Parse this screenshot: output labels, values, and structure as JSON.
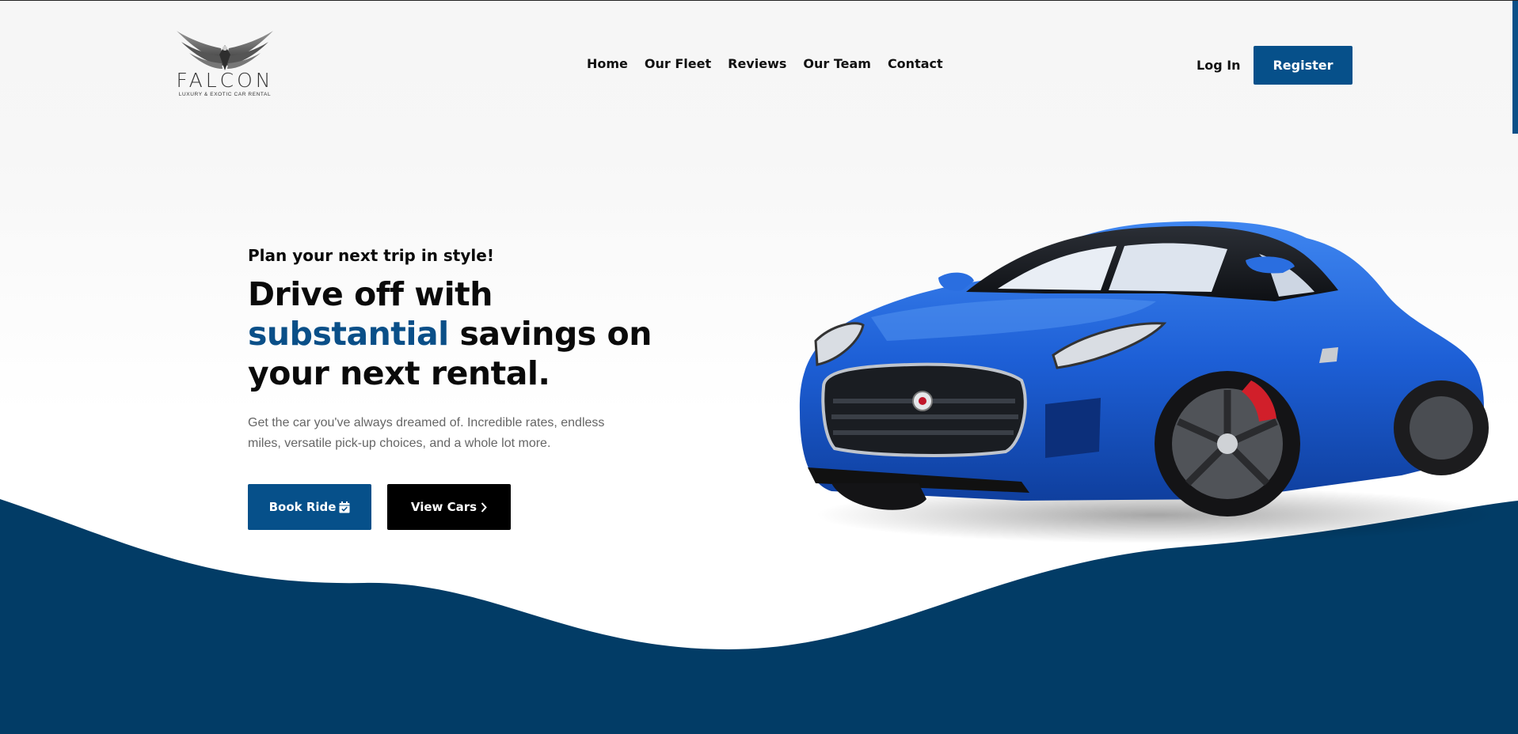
{
  "brand": {
    "name": "FALCON",
    "tagline": "LUXURY & EXOTIC CAR RENTAL",
    "logo_icon": "falcon-wings-icon"
  },
  "nav": {
    "items": [
      {
        "label": "Home"
      },
      {
        "label": "Our Fleet"
      },
      {
        "label": "Reviews"
      },
      {
        "label": "Our Team"
      },
      {
        "label": "Contact"
      }
    ]
  },
  "auth": {
    "login_label": "Log In",
    "register_label": "Register"
  },
  "hero": {
    "eyebrow": "Plan your next trip in style!",
    "headline_part1": "Drive off with ",
    "headline_accent": "substantial",
    "headline_part2": " savings on your next rental.",
    "description": "Get the car you've always dreamed of. Incredible rates, endless miles, versatile pick-up choices, and a whole lot more.",
    "book_label": "Book Ride",
    "book_icon": "calendar-check-icon",
    "view_label": "View Cars",
    "view_icon": "chevron-right-icon",
    "image": "blue-sports-car"
  },
  "colors": {
    "primary": "#06508a",
    "accent_text": "#0a4f88",
    "wave": "#023c66",
    "dark_button": "#000000",
    "car_body": "#1d5fd6"
  }
}
